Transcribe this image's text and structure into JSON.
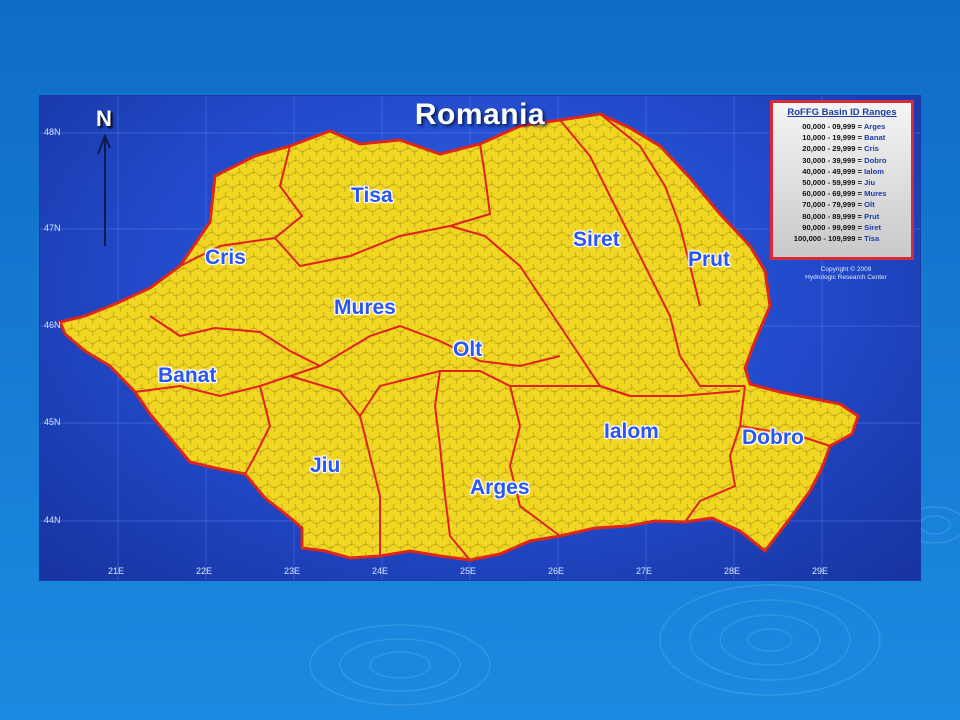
{
  "map": {
    "title": "Romania",
    "north": "N",
    "latitudes": [
      "48N",
      "47N",
      "46N",
      "45N",
      "44N"
    ],
    "longitudes": [
      "21E",
      "22E",
      "23E",
      "24E",
      "25E",
      "26E",
      "27E",
      "28E",
      "29E"
    ],
    "basins": [
      "Tisa",
      "Cris",
      "Siret",
      "Prut",
      "Mures",
      "Olt",
      "Banat",
      "Ialom",
      "Dobro",
      "Jiu",
      "Arges"
    ],
    "colors": {
      "land": "#f1d622",
      "border": "#e0231c",
      "label": "#2a56f2",
      "water": "#2149c9"
    }
  },
  "legend": {
    "title": "RoFFG Basin ID Ranges",
    "rows": [
      {
        "range": "00,000 -   09,999 =",
        "name": "Arges"
      },
      {
        "range": "10,000 -   19,999 =",
        "name": "Banat"
      },
      {
        "range": "20,000 -   29,999 =",
        "name": "Cris"
      },
      {
        "range": "30,000 -   39,999 =",
        "name": "Dobro"
      },
      {
        "range": "40,000 -   49,999 =",
        "name": "Ialom"
      },
      {
        "range": "50,000 -   59,999 =",
        "name": "Jiu"
      },
      {
        "range": "60,000 -   69,999 =",
        "name": "Mures"
      },
      {
        "range": "70,000 -   79,999 =",
        "name": "Olt"
      },
      {
        "range": "80,000 -   89,999 =",
        "name": "Prut"
      },
      {
        "range": "90,000 -   99,999 =",
        "name": "Siret"
      },
      {
        "range": "100,000 - 109,999 =",
        "name": "Tisa"
      }
    ]
  },
  "copyright": {
    "line1": "Copyright © 2009",
    "line2": "Hydrologic Research Center"
  }
}
